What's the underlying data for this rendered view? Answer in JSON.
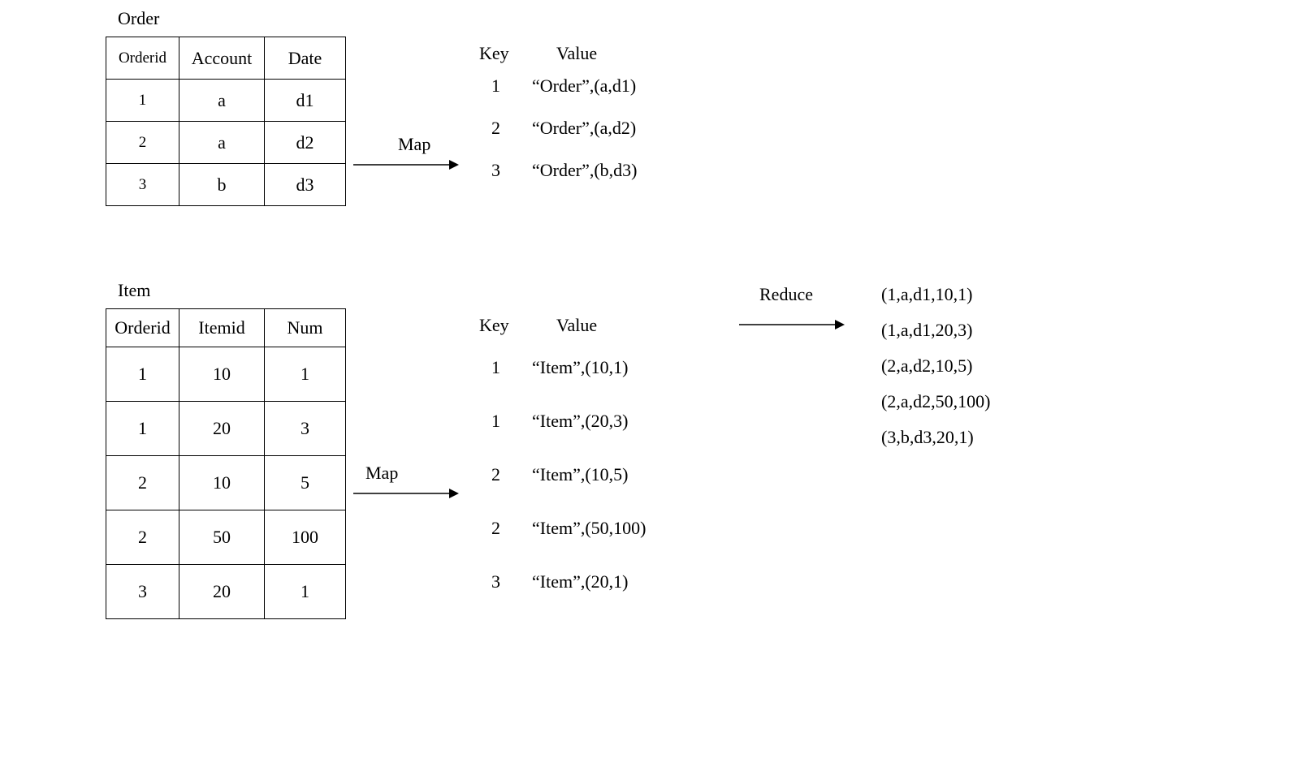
{
  "order": {
    "title": "Order",
    "headers": [
      "Orderid",
      "Account",
      "Date"
    ],
    "rows": [
      [
        "1",
        "a",
        "d1"
      ],
      [
        "2",
        "a",
        "d2"
      ],
      [
        "3",
        "b",
        "d3"
      ]
    ]
  },
  "item": {
    "title": "Item",
    "headers": [
      "Orderid",
      "Itemid",
      "Num"
    ],
    "rows": [
      [
        "1",
        "10",
        "1"
      ],
      [
        "1",
        "20",
        "3"
      ],
      [
        "2",
        "10",
        "5"
      ],
      [
        "2",
        "50",
        "100"
      ],
      [
        "3",
        "20",
        "1"
      ]
    ]
  },
  "map1": {
    "label": "Map",
    "keyLabel": "Key",
    "valueLabel": "Value",
    "rows": [
      {
        "k": "1",
        "v": "“Order”,(a,d1)"
      },
      {
        "k": "2",
        "v": "“Order”,(a,d2)"
      },
      {
        "k": "3",
        "v": "“Order”,(b,d3)"
      }
    ]
  },
  "map2": {
    "label": "Map",
    "keyLabel": "Key",
    "valueLabel": "Value",
    "rows": [
      {
        "k": "1",
        "v": "“Item”,(10,1)"
      },
      {
        "k": "1",
        "v": "“Item”,(20,3)"
      },
      {
        "k": "2",
        "v": "“Item”,(10,5)"
      },
      {
        "k": "2",
        "v": "“Item”,(50,100)"
      },
      {
        "k": "3",
        "v": "“Item”,(20,1)"
      }
    ]
  },
  "reduce": {
    "label": "Reduce",
    "results": [
      "(1,a,d1,10,1)",
      "(1,a,d1,20,3)",
      "(2,a,d2,10,5)",
      "(2,a,d2,50,100)",
      "(3,b,d3,20,1)"
    ]
  }
}
